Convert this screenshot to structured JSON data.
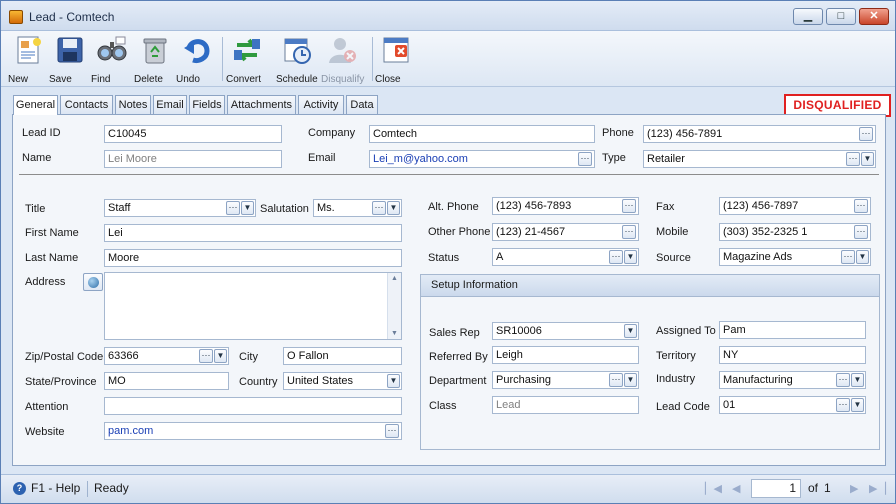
{
  "window": {
    "title": "Lead - Comtech",
    "minimize": "▁",
    "maximize": "□",
    "close": "✕"
  },
  "toolbar": {
    "new": "New",
    "save": "Save",
    "find": "Find",
    "delete": "Delete",
    "undo": "Undo",
    "convert": "Convert",
    "schedule": "Schedule",
    "disqualify": "Disqualify",
    "close": "Close"
  },
  "tabs": [
    "General",
    "Contacts",
    "Notes",
    "Email",
    "Fields",
    "Attachments",
    "Activity",
    "Data"
  ],
  "status_badge": "DISQUALIFIED",
  "header": {
    "lead_id_label": "Lead ID",
    "lead_id": "C10045",
    "name_label": "Name",
    "name": "Lei Moore",
    "company_label": "Company",
    "company": "Comtech",
    "email_label": "Email",
    "email": "Lei_m@yahoo.com",
    "phone_label": "Phone",
    "phone": "(123) 456-7891",
    "type_label": "Type",
    "type": "Retailer"
  },
  "contact": {
    "title_label": "Title",
    "title": "Staff",
    "salutation_label": "Salutation",
    "salutation": "Ms.",
    "first_name_label": "First Name",
    "first_name": "Lei",
    "last_name_label": "Last Name",
    "last_name": "Moore",
    "address_label": "Address",
    "address": "",
    "zip_label": "Zip/Postal Code",
    "zip": "63366",
    "city_label": "City",
    "city": "O Fallon",
    "state_label": "State/Province",
    "state": "MO",
    "country_label": "Country",
    "country": "United States",
    "attention_label": "Attention",
    "attention": "",
    "website_label": "Website",
    "website": "pam.com"
  },
  "phones": {
    "alt_phone_label": "Alt. Phone",
    "alt_phone": "(123) 456-7893",
    "other_phone_label": "Other Phone",
    "other_phone": "(123) 21-4567",
    "status_label": "Status",
    "status": "A",
    "fax_label": "Fax",
    "fax": "(123) 456-7897",
    "mobile_label": "Mobile",
    "mobile": "(303) 352-2325 1",
    "source_label": "Source",
    "source": "Magazine Ads"
  },
  "setup": {
    "heading": "Setup Information",
    "sales_rep_label": "Sales Rep",
    "sales_rep": "SR10006",
    "referred_by_label": "Referred By",
    "referred_by": "Leigh",
    "department_label": "Department",
    "department": "Purchasing",
    "class_label": "Class",
    "class_placeholder": "Lead",
    "assigned_to_label": "Assigned To",
    "assigned_to": "Pam",
    "territory_label": "Territory",
    "territory": "NY",
    "industry_label": "Industry",
    "industry": "Manufacturing",
    "lead_code_label": "Lead Code",
    "lead_code": "01"
  },
  "statusbar": {
    "help": "F1 - Help",
    "help_icon": "?",
    "state": "Ready",
    "page": "1",
    "of_label": "of",
    "total_pages": "1"
  },
  "colors": {
    "badge": "#e02020",
    "accent": "#2d62b0"
  }
}
